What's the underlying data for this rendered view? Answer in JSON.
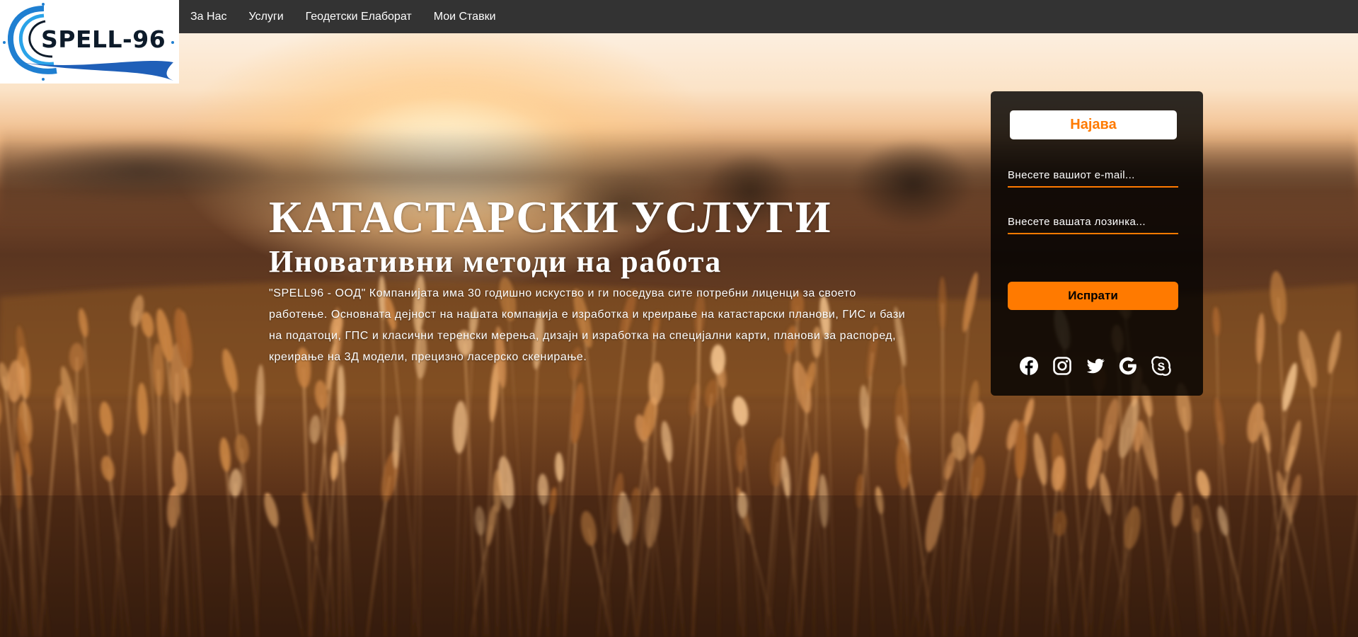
{
  "logo": {
    "text": "SPELL-96"
  },
  "nav": {
    "items": [
      {
        "label": "За Нас"
      },
      {
        "label": "Услуги"
      },
      {
        "label": "Геодетски Елаборат"
      },
      {
        "label": "Мои Ставки"
      }
    ]
  },
  "hero": {
    "title": "КАТАСТАРСКИ УСЛУГИ",
    "subtitle": "Иновативни методи на работа",
    "description": "\"SPELL96 - ООД\" Компанијата има 30 годишно искуство и ги поседува сите потребни лиценци за своето работење. Основната дејност на нашата компанија е изработка и креирање на катастарски планови, ГИС и бази на податоци, ГПС и класични теренски мерења, дизајн и изработка на специјални карти, планови за распоред, креирање на 3Д модели, прецизно ласерско скенирање."
  },
  "login": {
    "header": "Најава",
    "email_placeholder": "Внесете вашиот e-mail...",
    "password_placeholder": "Внесете вашата лозинка...",
    "submit_label": "Испрати",
    "socials": [
      "facebook-icon",
      "instagram-icon",
      "twitter-icon",
      "google-icon",
      "skype-icon"
    ]
  },
  "colors": {
    "accent": "#ff7a00",
    "navbar": "#333333",
    "logo_text": "#0d1b2a",
    "logo_swoosh": "#1f7fd1"
  }
}
